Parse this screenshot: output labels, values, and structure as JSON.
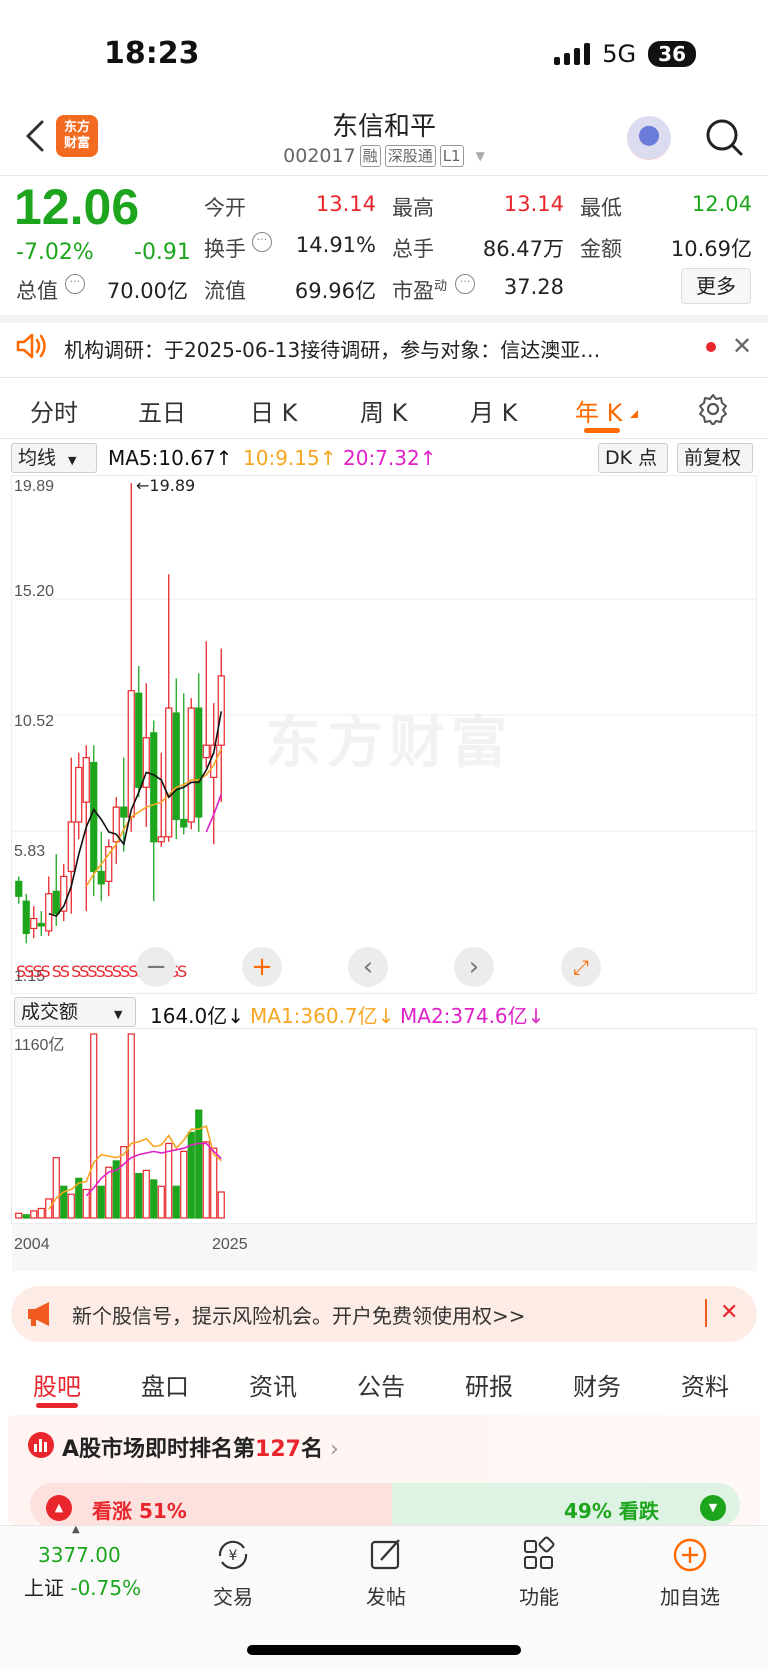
{
  "status": {
    "time": "18:23",
    "network": "5G",
    "battery": "36"
  },
  "header": {
    "title": "东信和平",
    "code": "002017",
    "tags": [
      "融",
      "深股通",
      "L1"
    ],
    "logo_text": "东方财富"
  },
  "quote": {
    "price": "12.06",
    "change_pct": "-7.02%",
    "change": "-0.91",
    "open_label": "今开",
    "open": "13.14",
    "high_label": "最高",
    "high": "13.14",
    "low_label": "最低",
    "low": "12.04",
    "turnover_label": "换手",
    "turnover": "14.91%",
    "volume_label": "总手",
    "volume": "86.47万",
    "amount_label": "金额",
    "amount": "10.69亿",
    "mktcap_label": "总值",
    "mktcap": "70.00亿",
    "float_label": "流值",
    "float_cap": "69.96亿",
    "pe_label": "市盈",
    "pe_sup": "动",
    "pe": "37.28",
    "more": "更多"
  },
  "notice": {
    "text": "机构调研：于2025-06-13接待调研，参与对象：信达澳亚…"
  },
  "chart_tabs": [
    "分时",
    "五日",
    "日 K",
    "周 K",
    "月 K",
    "年 K"
  ],
  "indicator": {
    "selector": "均线",
    "ma5": "MA5:10.67↑",
    "ma10": "10:9.15↑",
    "ma20": "20:7.32↑",
    "dk": "DK 点",
    "adjust": "前复权"
  },
  "price_axis": [
    "19.89",
    "15.20",
    "10.52",
    "5.83",
    "1.15"
  ],
  "max_marker": "←19.89",
  "vol_indicator": {
    "selector": "成交额",
    "value": "164.0亿↓",
    "ma1": "MA1:360.7亿↓",
    "ma2": "MA2:374.6亿↓",
    "axis_top": "1160亿"
  },
  "x_axis": [
    "2004",
    "2025"
  ],
  "ad": {
    "text": "新个股信号，提示风险机会。开户免费领使用权>>"
  },
  "bottom_tabs": [
    "股吧",
    "盘口",
    "资讯",
    "公告",
    "研报",
    "财务",
    "资料"
  ],
  "rank": {
    "prefix": "A股市场即时排名第",
    "rank": "127",
    "suffix": "名"
  },
  "vote": {
    "up": "看涨 51%",
    "down": "49% 看跌"
  },
  "index": {
    "value": "3377.00",
    "name": "上证",
    "change": "-0.75%"
  },
  "nav": [
    "交易",
    "发帖",
    "功能",
    "加自选"
  ],
  "colors": {
    "up": "#e8262c",
    "down": "#1ea51e",
    "accent": "#ff6a00",
    "ma5": "#111111",
    "ma10": "#f6a623",
    "ma20": "#e020c8"
  },
  "chart_data": {
    "type": "candlestick",
    "period": "yearly",
    "y_range": [
      1.15,
      19.89
    ],
    "candles": [
      {
        "o": 3.8,
        "h": 4.0,
        "l": 2.9,
        "c": 3.2
      },
      {
        "o": 3.0,
        "h": 3.3,
        "l": 1.3,
        "c": 1.7
      },
      {
        "o": 1.9,
        "h": 2.8,
        "l": 1.5,
        "c": 2.3
      },
      {
        "o": 2.1,
        "h": 2.6,
        "l": 1.6,
        "c": 2.0
      },
      {
        "o": 1.8,
        "h": 4.0,
        "l": 1.6,
        "c": 3.3
      },
      {
        "o": 3.4,
        "h": 4.9,
        "l": 2.0,
        "c": 2.5
      },
      {
        "o": 2.6,
        "h": 4.5,
        "l": 2.2,
        "c": 4.0
      },
      {
        "o": 4.2,
        "h": 8.8,
        "l": 2.5,
        "c": 6.2
      },
      {
        "o": 6.2,
        "h": 9.0,
        "l": 5.5,
        "c": 8.4
      },
      {
        "o": 7.0,
        "h": 9.3,
        "l": 2.6,
        "c": 8.8
      },
      {
        "o": 8.6,
        "h": 9.3,
        "l": 3.2,
        "c": 4.2
      },
      {
        "o": 4.2,
        "h": 5.8,
        "l": 3.0,
        "c": 3.7
      },
      {
        "o": 3.8,
        "h": 5.5,
        "l": 3.2,
        "c": 5.2
      },
      {
        "o": 5.4,
        "h": 7.2,
        "l": 4.5,
        "c": 6.8
      },
      {
        "o": 6.8,
        "h": 8.8,
        "l": 5.0,
        "c": 6.4
      },
      {
        "o": 6.4,
        "h": 19.89,
        "l": 5.8,
        "c": 11.5
      },
      {
        "o": 11.4,
        "h": 12.5,
        "l": 7.2,
        "c": 7.6
      },
      {
        "o": 7.6,
        "h": 11.8,
        "l": 6.0,
        "c": 9.6
      },
      {
        "o": 9.8,
        "h": 10.3,
        "l": 3.0,
        "c": 5.4
      },
      {
        "o": 5.4,
        "h": 9.0,
        "l": 5.2,
        "c": 5.6
      },
      {
        "o": 5.6,
        "h": 16.2,
        "l": 5.4,
        "c": 10.8
      },
      {
        "o": 10.6,
        "h": 12.0,
        "l": 5.5,
        "c": 6.3
      },
      {
        "o": 6.3,
        "h": 11.4,
        "l": 5.7,
        "c": 6.0
      },
      {
        "o": 6.2,
        "h": 11.2,
        "l": 5.9,
        "c": 10.8
      },
      {
        "o": 10.8,
        "h": 12.2,
        "l": 5.8,
        "c": 6.4
      },
      {
        "o": 8.8,
        "h": 13.5,
        "l": 8.4,
        "c": 9.3
      },
      {
        "o": 8.0,
        "h": 11.0,
        "l": 5.3,
        "c": 9.3
      },
      {
        "o": 9.3,
        "h": 13.2,
        "l": 7.0,
        "c": 12.1
      }
    ],
    "ma5": [
      null,
      null,
      null,
      null,
      2.5,
      2.4,
      2.8,
      3.6,
      4.9,
      6.0,
      6.7,
      6.3,
      5.8,
      5.7,
      5.3,
      6.7,
      7.4,
      8.2,
      8.1,
      7.9,
      7.2,
      7.5,
      7.6,
      7.8,
      7.8,
      8.3,
      9.0,
      10.67
    ],
    "ma10": [
      null,
      null,
      null,
      null,
      null,
      null,
      null,
      null,
      null,
      3.6,
      4.1,
      4.5,
      4.9,
      5.3,
      5.9,
      6.4,
      6.6,
      6.8,
      6.9,
      7.0,
      7.3,
      7.6,
      7.7,
      7.9,
      7.9,
      8.1,
      8.5,
      9.15
    ],
    "ma20": [
      null,
      null,
      null,
      null,
      null,
      null,
      null,
      null,
      null,
      null,
      null,
      null,
      null,
      null,
      null,
      null,
      null,
      null,
      null,
      null,
      null,
      null,
      null,
      null,
      null,
      5.8,
      6.5,
      7.32
    ],
    "volume_yi": [
      30,
      20,
      45,
      60,
      120,
      380,
      200,
      150,
      250,
      180,
      1160,
      200,
      320,
      360,
      450,
      1160,
      280,
      300,
      240,
      200,
      470,
      200,
      420,
      540,
      680,
      480,
      440,
      164
    ],
    "volume_up": [
      true,
      false,
      true,
      true,
      true,
      true,
      false,
      true,
      false,
      true,
      true,
      false,
      true,
      false,
      true,
      true,
      false,
      true,
      false,
      true,
      true,
      false,
      true,
      false,
      false,
      true,
      true,
      true
    ],
    "vol_ma1": [
      null,
      null,
      null,
      null,
      55,
      125,
      165,
      180,
      220,
      230,
      350,
      400,
      390,
      380,
      400,
      470,
      480,
      500,
      450,
      460,
      520,
      440,
      490,
      560,
      560,
      580,
      400,
      360.7
    ],
    "vol_ma2": [
      null,
      null,
      null,
      null,
      null,
      null,
      null,
      null,
      null,
      140,
      190,
      250,
      290,
      300,
      340,
      380,
      400,
      410,
      420,
      410,
      420,
      430,
      440,
      460,
      470,
      470,
      420,
      374.6
    ]
  }
}
